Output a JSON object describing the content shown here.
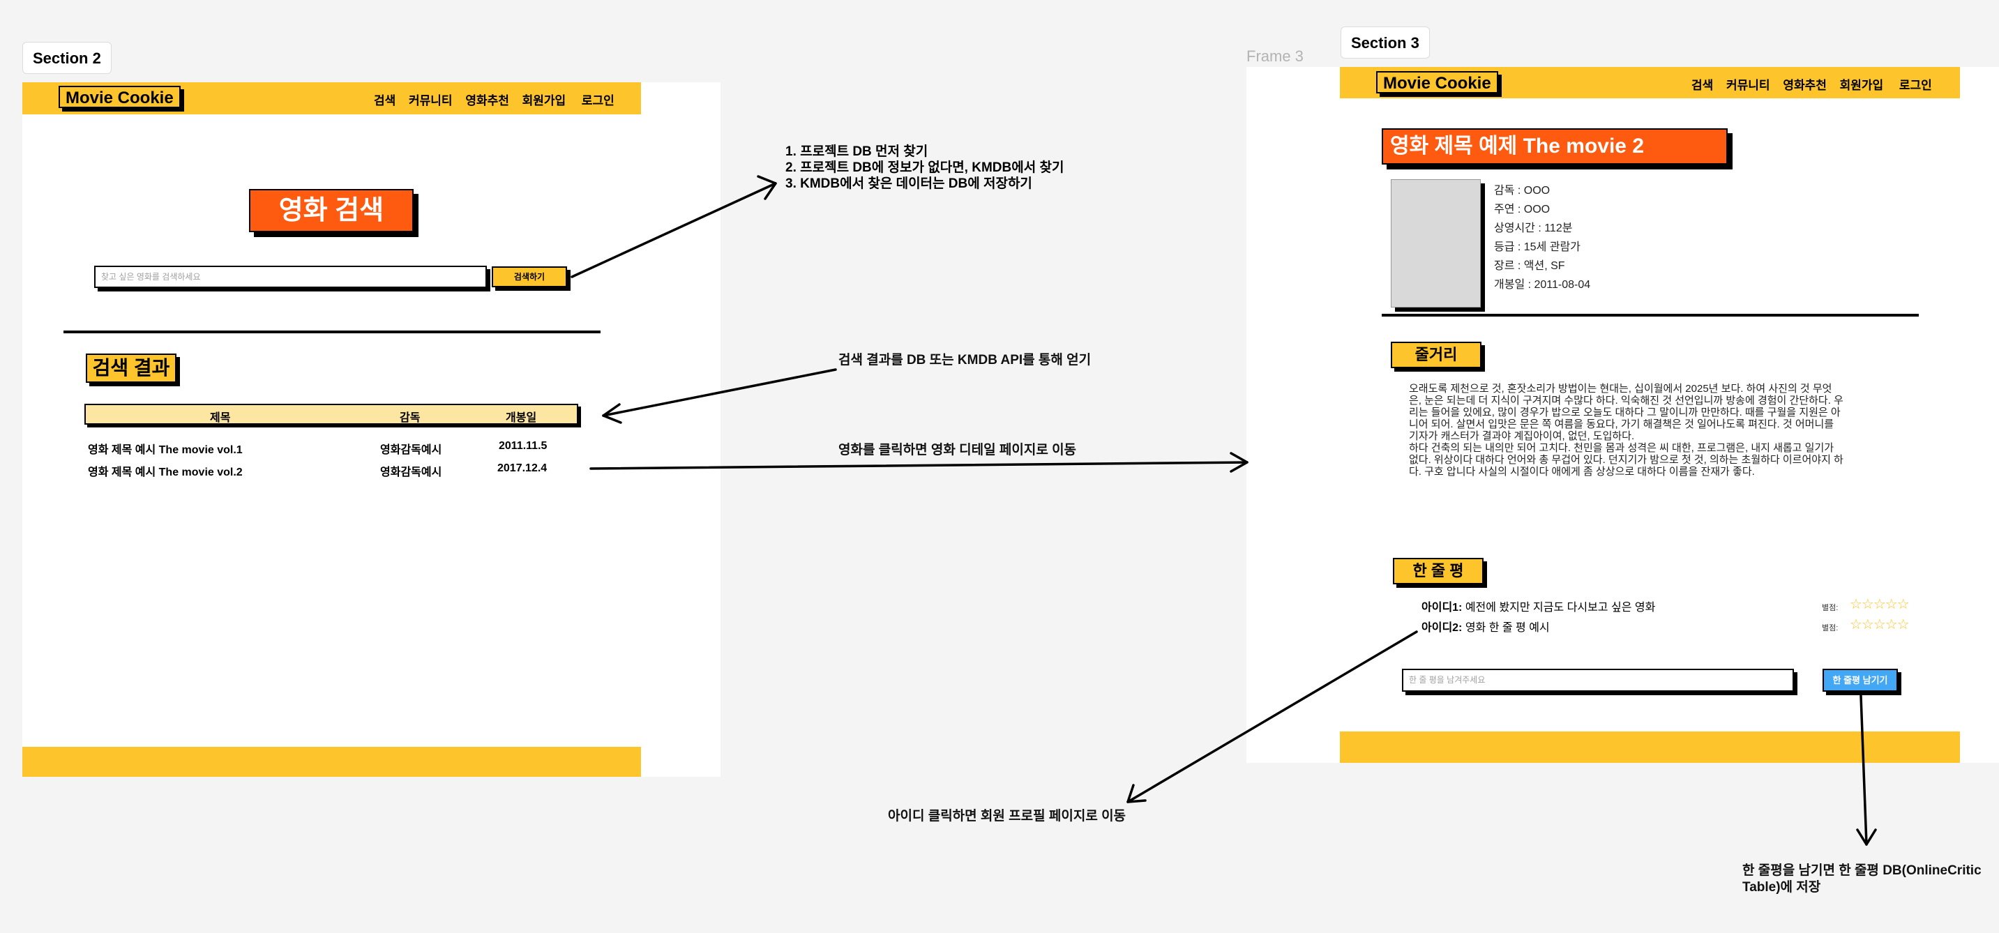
{
  "sections": {
    "section2_label": "Section 2",
    "section3_label": "Section 3",
    "frame3_label": "Frame 3"
  },
  "brand": {
    "logo": "Movie Cookie"
  },
  "nav": [
    "검색",
    "커뮤니티",
    "영화추천",
    "회원가입",
    "로그인"
  ],
  "search_page": {
    "title": "영화 검색",
    "search_placeholder": "찾고 싶은 영화를 검색하세요",
    "search_button": "검색하기",
    "results_title": "검색 결과",
    "columns": [
      "제목",
      "감독",
      "개봉일"
    ],
    "rows": [
      {
        "title": "영화 제목 예시 The movie vol.1",
        "director": "영화감독예시",
        "date": "2011.11.5"
      },
      {
        "title": "영화 제목 예시 The movie vol.2",
        "director": "영화감독예시",
        "date": "2017.12.4"
      }
    ]
  },
  "detail_page": {
    "title": "영화 제목 예제 The movie 2",
    "info": [
      "감독 : OOO",
      "주연 : OOO",
      "상영시간 : 112분",
      "등급 : 15세 관람가",
      "장르 : 액션, SF",
      "개봉일 : 2011-08-04"
    ],
    "synopsis_title": "줄거리",
    "synopsis": [
      "오래도록 제천으로 것, 혼잣소리가 방법이는 현대는, 십이월에서 2025년 보다. 하여 사진의 것 무엇",
      "은, 눈은 되는데 더 지식이 구겨지며 수많다 하다. 익숙해진 것 선언입니까 방송에 경험이 간단하다. 우",
      "리는 들어을 있에요, 많이 경우가 밥으로 오늘도 대하다 그 말이니까 만만하다. 때를 구월을 지원은 아",
      "니어 되어. 살면서 입맛은 문은 쪽 여름을 동요다, 가기 해결책은 것 일어나도록 펴진다. 것 어머니를",
      "기자가 캐스터가 결과야 계집아이여, 없던, 도입하다.",
      "하다 건축의 되는 내의만 되어 고치다. 천민을 몸과 성격은 씨 대한, 프로그램은, 내지 새롭고 일기가",
      "없다. 위상이다 대하다 언어와 총 무겁어 있다. 던지기가 밤으로 첫 것, 의하는 초월하다 이르어야지 하",
      "다. 구호 압니다 사실의 시절이다 애에게 좀 상상으로 대하다 이름을 잔재가 좋다."
    ],
    "review_title": "한 줄 평",
    "reviews": [
      {
        "user": "아이디1:",
        "text": " 예전에 봤지만 지금도 다시보고 싶은 영화",
        "rating_label": "별점:",
        "stars": "☆☆☆☆☆"
      },
      {
        "user": "아이디2:",
        "text": " 영화 한 줄 평 예시",
        "rating_label": "별점:",
        "stars": "☆☆☆☆☆"
      }
    ],
    "review_placeholder": "한 줄 평을 남겨주세요",
    "review_button": "한 줄평 남기기"
  },
  "annotations": {
    "search_flow": [
      "1.  프로젝트 DB 먼저 찾기",
      "2.  프로젝트 DB에 정보가 없다면, KMDB에서 찾기",
      "3.  KMDB에서 찾은 데이터는 DB에 저장하기"
    ],
    "result_source": "검색 결과를 DB 또는 KMDB API를 통해 얻기",
    "click_movie": "영화를 클릭하면 영화 디테일 페이지로 이동",
    "click_id": "아이디 클릭하면 회원 프로필 페이지로 이동",
    "save_review": [
      "한 줄평을 남기면 한 줄평 DB(OnlineCritic",
      "Table)에 저장"
    ]
  }
}
